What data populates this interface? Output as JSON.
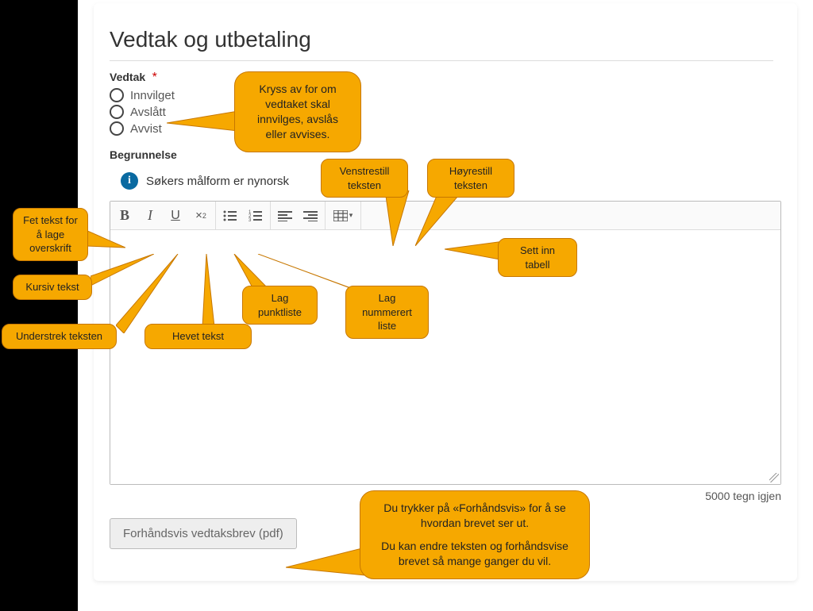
{
  "page": {
    "heading": "Vedtak og utbetaling",
    "vedtak_label": "Vedtak",
    "required_mark": "*",
    "radios": [
      "Innvilget",
      "Avslått",
      "Avvist"
    ],
    "begrunnelse_label": "Begrunnelse",
    "info_text": "Søkers målform er nynorsk",
    "char_counter": "5000 tegn igjen",
    "preview_button": "Forhåndsvis vedtaksbrev (pdf)"
  },
  "toolbar": {
    "bold_glyph": "B",
    "italic_glyph": "I",
    "underline_glyph": "U",
    "sup_glyph": "×",
    "sup_exp": "2",
    "table_caret": "▾"
  },
  "callouts": {
    "vedtak_hint": "Kryss av for om vedtaket skal innvilges, avslås eller avvises.",
    "bold": "Fet tekst for å lage overskrift",
    "italic": "Kursiv tekst",
    "underline": "Understrek teksten",
    "sup": "Hevet tekst",
    "ul": "Lag punktliste",
    "ol": "Lag nummerert liste",
    "align_left": "Venstrestill teksten",
    "align_right": "Høyrestill teksten",
    "table": "Sett inn tabell",
    "preview_hint_1": "Du trykker på «Forhåndsvis» for å se hvordan brevet ser ut.",
    "preview_hint_2": "Du kan endre teksten og forhåndsvise brevet så mange ganger du vil."
  },
  "colors": {
    "callout": "#f6a800",
    "callout_border": "#c77700",
    "info_icon": "#0a6aa1"
  }
}
